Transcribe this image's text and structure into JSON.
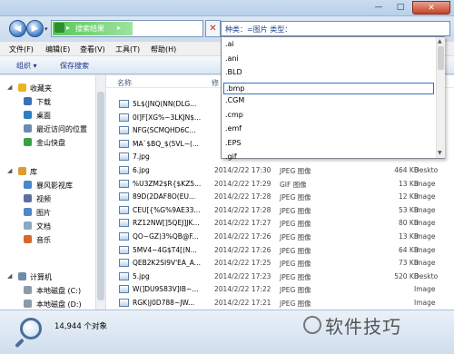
{
  "toolbar": {
    "organize": "组织 ▾",
    "save_search": "保存搜索"
  },
  "address": {
    "path": "搜索结果",
    "separator": "▸"
  },
  "search": {
    "query": "种类：=图片 类型："
  },
  "menu": [
    "文件(F)",
    "编辑(E)",
    "查看(V)",
    "工具(T)",
    "帮助(H)"
  ],
  "sidebar": {
    "groups": [
      {
        "label": "收藏夹",
        "color": "#e8b422",
        "items": [
          {
            "label": "下载",
            "color": "#3d6fb8"
          },
          {
            "label": "桌面",
            "color": "#2f7ec0"
          },
          {
            "label": "最近访问的位置",
            "color": "#6c8ab0"
          },
          {
            "label": "金山快盘",
            "color": "#3aa142"
          }
        ]
      },
      {
        "label": "库",
        "color": "#d99e2c",
        "items": [
          {
            "label": "暴风影视库",
            "color": "#4a86c8"
          },
          {
            "label": "视频",
            "color": "#5d6fa0"
          },
          {
            "label": "图片",
            "color": "#4f87c9"
          },
          {
            "label": "文档",
            "color": "#8da6c6"
          },
          {
            "label": "音乐",
            "color": "#d66a2a"
          }
        ]
      },
      {
        "label": "计算机",
        "color": "#6d89ad",
        "items": [
          {
            "label": "本地磁盘 (C:)",
            "color": "#8c9aa8"
          },
          {
            "label": "本地磁盘 (D:)",
            "color": "#8c9aa8"
          }
        ]
      }
    ]
  },
  "columns": {
    "name": "名称",
    "date": "修"
  },
  "files": [
    {
      "name": "5L$(JNQ(NN(DLG...",
      "date": "",
      "type": "",
      "size": "",
      "path": ""
    },
    {
      "name": "0I]F[XG%~3LKJN$...",
      "date": "",
      "type": "",
      "size": "",
      "path": ""
    },
    {
      "name": "NFG(SCMQHD6C...",
      "date": "",
      "type": "",
      "size": "",
      "path": ""
    },
    {
      "name": "MA`$BQ_$(5VL~(...",
      "date": "",
      "type": "",
      "size": "",
      "path": ""
    },
    {
      "name": "7.jpg",
      "date": "",
      "type": "",
      "size": "",
      "path": ""
    },
    {
      "name": "6.jpg",
      "date": "2014/2/22 17:30",
      "type": "JPEG 图像",
      "size": "464 KB",
      "path": "Deskto"
    },
    {
      "name": "%U3ZM2$R{$KZ5...",
      "date": "2014/2/22 17:29",
      "type": "GIF 图像",
      "size": "13 KB",
      "path": "Image"
    },
    {
      "name": "89D(2DAF8O(EU...",
      "date": "2014/2/22 17:28",
      "type": "JPEG 图像",
      "size": "12 KB",
      "path": "Image"
    },
    {
      "name": "CEU[{%G%9AE33...",
      "date": "2014/2/22 17:28",
      "type": "JPEG 图像",
      "size": "53 KB",
      "path": "Image"
    },
    {
      "name": "RZ12NW[]5QEJ]JK...",
      "date": "2014/2/22 17:27",
      "type": "JPEG 图像",
      "size": "80 KB",
      "path": "Image"
    },
    {
      "name": "QO~GZ)3%QB@F...",
      "date": "2014/2/22 17:26",
      "type": "JPEG 图像",
      "size": "13 KB",
      "path": "Image"
    },
    {
      "name": "5MV4~4G$T4[(N...",
      "date": "2014/2/22 17:26",
      "type": "JPEG 图像",
      "size": "64 KB",
      "path": "Image"
    },
    {
      "name": "QEB2K2SI9V'EA_A...",
      "date": "2014/2/22 17:25",
      "type": "JPEG 图像",
      "size": "73 KB",
      "path": "Image"
    },
    {
      "name": "5.jpg",
      "date": "2014/2/22 17:23",
      "type": "JPEG 图像",
      "size": "520 KB",
      "path": "Deskto"
    },
    {
      "name": "W(]DU9S83V]IB~...",
      "date": "2014/2/22 17:22",
      "type": "JPEG 图像",
      "size": "",
      "path": "Image"
    },
    {
      "name": "RGK)J0D788~JW...",
      "date": "2014/2/22 17:21",
      "type": "JPEG 图像",
      "size": "",
      "path": "Image"
    }
  ],
  "dropdown": {
    "items": [
      ".ai",
      ".ani",
      ".BLD",
      ".bmp",
      ".CGM",
      ".cmp",
      ".emf",
      ".EPS",
      ".gif"
    ],
    "selected": ".bmp"
  },
  "status": {
    "count": "14,944 个对象"
  },
  "watermark": "软件技巧"
}
